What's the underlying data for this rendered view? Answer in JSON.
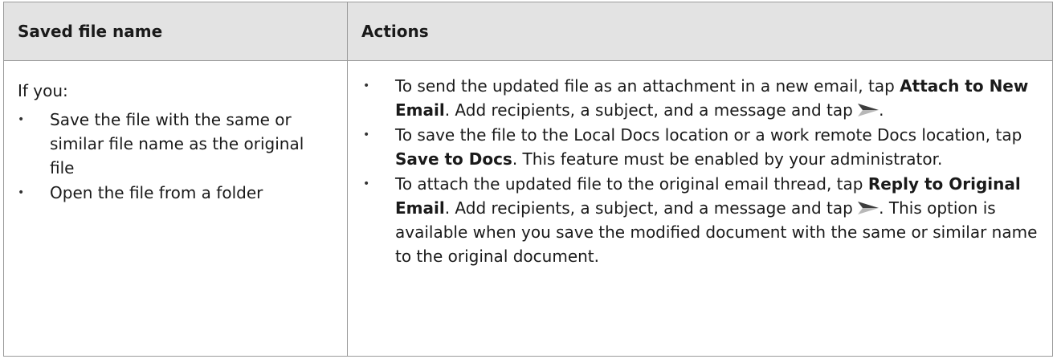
{
  "table": {
    "headers": {
      "col1": "Saved file name",
      "col2": "Actions"
    },
    "left": {
      "intro": "If you:",
      "items": [
        "Save the file with the same or similar file name as the original file",
        "Open the file from a folder"
      ]
    },
    "right": {
      "item1": {
        "pre": "To send the updated file as an attachment in a new email, tap ",
        "bold": "Attach to New Email",
        "mid": ". Add recipients, a subject, and a message and tap ",
        "post": "."
      },
      "item2": {
        "pre": "To save the file to the Local Docs location or a work remote Docs location, tap ",
        "bold": "Save to Docs",
        "post": ". This feature must be enabled by your administrator."
      },
      "item3": {
        "pre": "To attach the updated file to the original email thread, tap ",
        "bold": "Reply to Original Email",
        "mid": ". Add recipients, a subject, and a message and tap ",
        "post": ". This option is available when you save the modified document with the same or similar name to the original document."
      }
    },
    "bullet_glyph": "•",
    "icons": {
      "send": "send-icon"
    },
    "colors": {
      "header_bg": "#e3e3e3",
      "border": "#9a9a9a",
      "send_icon_light": "#b8b8b8",
      "send_icon_dark": "#3d3d3d"
    }
  }
}
